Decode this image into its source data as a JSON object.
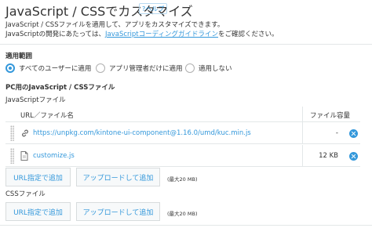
{
  "header": {
    "title": "JavaScript / CSSでカスタマイズ",
    "help_label": "?ヘルプ",
    "desc_line1": "JavaScript / CSSファイルを適用して、アプリをカスタマイズできます。",
    "desc_line2_prefix": "JavaScriptの開発にあたっては、",
    "desc_line2_link": "JavaScriptコーディングガイドライン",
    "desc_line2_suffix": "をご確認ください。"
  },
  "scope": {
    "label": "適用範囲",
    "options": [
      {
        "label": "すべてのユーザーに適用",
        "selected": true
      },
      {
        "label": "アプリ管理者だけに適用",
        "selected": false
      },
      {
        "label": "適用しない",
        "selected": false
      }
    ]
  },
  "pc_section": {
    "title": "PC用のJavaScript / CSSファイル",
    "js_label": "JavaScriptファイル",
    "table": {
      "col_url": "URL／ファイル名",
      "col_size": "ファイル容量",
      "rows": [
        {
          "type": "link",
          "name": "https://unpkg.com/kintone-ui-component@1.16.0/umd/kuc.min.js",
          "size": "-"
        },
        {
          "type": "file",
          "name": "customize.js",
          "size": "12 KB"
        }
      ]
    },
    "buttons": {
      "add_url": "URL指定で追加",
      "upload": "アップロードして追加",
      "max_note": "(最大20 MB)"
    },
    "css_label": "CSSファイル"
  },
  "colors": {
    "accent": "#3498db",
    "border": "#e3e7e8",
    "button_bg": "#f7f9fa"
  },
  "icons": {
    "link": "link-icon",
    "file": "file-icon",
    "delete": "delete-circle-icon",
    "grip": "drag-handle-icon"
  }
}
